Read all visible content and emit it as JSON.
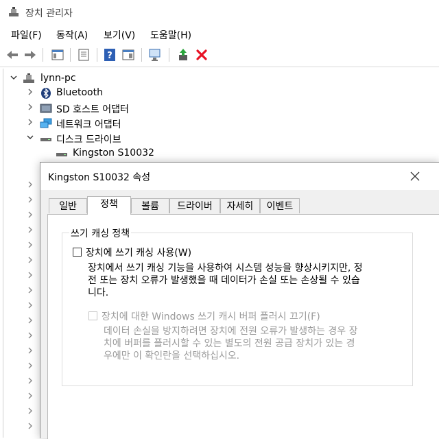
{
  "window": {
    "title": "장치 관리자"
  },
  "menu": [
    "파일(F)",
    "동작(A)",
    "보기(V)",
    "도움말(H)"
  ],
  "tree": {
    "root": "lynn-pc",
    "items": [
      "Bluetooth",
      "SD 호스트 어댑터",
      "네트워크 어댑터",
      "디스크 드라이브"
    ],
    "child": "Kingston S10032"
  },
  "dialog": {
    "title": "Kingston S10032 속성",
    "tabs": [
      "일반",
      "정책",
      "볼륨",
      "드라이버",
      "자세히",
      "이벤트"
    ],
    "active_tab": "정책",
    "group_title": "쓰기 캐싱 정책",
    "option1": {
      "label": "장치에 쓰기 캐싱 사용(W)",
      "checked": false,
      "desc_lines": [
        "장치에서 쓰기 캐싱 기능을 사용하여 시스템 성능을 향상시키지만, 정",
        "전 또는 장치 오류가 발생했을 때 데이터가 손실 또는 손상될 수 있습",
        "니다."
      ]
    },
    "option2": {
      "label": "장치에 대한 Windows 쓰기 캐시 버퍼 플러시 끄기(F)",
      "checked": false,
      "disabled": true,
      "desc_lines": [
        "데이터 손실을 방지하려면 장치에 전원 오류가 발생하는 경우 장",
        "치에 버퍼를 플러시할 수 있는 별도의 전원 공급 장치가 있는 경",
        "우에만 이 확인란을 선택하십시오."
      ]
    }
  },
  "colors": {
    "accent": "#0078d7",
    "delete": "#e81123",
    "disabled": "#9a9a9a"
  }
}
